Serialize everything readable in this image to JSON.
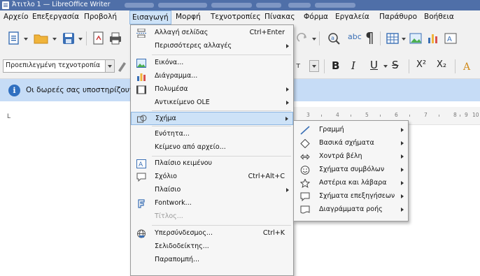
{
  "window": {
    "title": "Άτιτλο 1 — LibreOffice Writer"
  },
  "menubar": [
    {
      "label": "Αρχείο",
      "name": "menu-file"
    },
    {
      "label": "Επεξεργασία",
      "name": "menu-edit"
    },
    {
      "label": "Προβολή",
      "name": "menu-view"
    },
    {
      "label": "Εισαγωγή",
      "name": "menu-insert",
      "active": true
    },
    {
      "label": "Μορφή",
      "name": "menu-format"
    },
    {
      "label": "Τεχνοτροπίες",
      "name": "menu-styles"
    },
    {
      "label": "Πίνακας",
      "name": "menu-table"
    },
    {
      "label": "Φόρμα",
      "name": "menu-form"
    },
    {
      "label": "Εργαλεία",
      "name": "menu-tools"
    },
    {
      "label": "Παράθυρο",
      "name": "menu-window"
    },
    {
      "label": "Βοήθεια",
      "name": "menu-help"
    }
  ],
  "toolbar": {
    "paragraph_style": "Προεπιλεγμένη τεχνοτροπία",
    "bold": "B",
    "italic": "I",
    "underline": "U",
    "strikethrough": "S",
    "superscript": "X²",
    "subscript": "X₂",
    "paragraph_mark": "¶",
    "spellcheck": "abc"
  },
  "infobar": {
    "message": "Οι δωρεές σας υποστηρίζουν"
  },
  "ruler": {
    "ticks": [
      "3",
      "4",
      "5",
      "6",
      "7",
      "8",
      "9",
      "10"
    ]
  },
  "insert_menu": {
    "items": [
      {
        "label": "Αλλαγή σελίδας",
        "shortcut": "Ctrl+Enter",
        "icon": "page-break-icon"
      },
      {
        "label": "Περισσότερες αλλαγές",
        "submenu": true
      },
      {
        "label": "Εικόνα...",
        "icon": "image-icon"
      },
      {
        "label": "Διάγραμμα...",
        "icon": "chart-icon"
      },
      {
        "label": "Πολυμέσα",
        "icon": "media-icon",
        "submenu": true
      },
      {
        "label": "Αντικείμενο OLE",
        "submenu": true
      },
      {
        "label": "Σχήμα",
        "icon": "shape-icon",
        "submenu": true,
        "highlighted": true
      },
      {
        "label": "Ενότητα..."
      },
      {
        "label": "Κείμενο από αρχείο..."
      },
      {
        "label": "Πλαίσιο κειμένου",
        "icon": "text-box-icon"
      },
      {
        "label": "Σχόλιο",
        "shortcut": "Ctrl+Alt+C",
        "icon": "comment-icon"
      },
      {
        "label": "Πλαίσιο",
        "submenu": true
      },
      {
        "label": "Fontwork...",
        "icon": "fontwork-icon"
      },
      {
        "label": "Τίτλος...",
        "disabled": true
      },
      {
        "label": "Υπερσύνδεσμος...",
        "shortcut": "Ctrl+K",
        "icon": "hyperlink-icon"
      },
      {
        "label": "Σελιδοδείκτης..."
      },
      {
        "label": "Παραπομπή..."
      }
    ]
  },
  "shape_submenu": {
    "items": [
      {
        "label": "Γραμμή",
        "icon": "line-icon"
      },
      {
        "label": "Βασικά σχήματα",
        "icon": "diamond-icon"
      },
      {
        "label": "Χοντρά βέλη",
        "icon": "double-arrow-icon"
      },
      {
        "label": "Σχήματα συμβόλων",
        "icon": "smiley-icon"
      },
      {
        "label": "Αστέρια και λάβαρα",
        "icon": "star-icon"
      },
      {
        "label": "Σχήματα επεξηγήσεων",
        "icon": "callout-icon"
      },
      {
        "label": "Διαγράμματα ροής",
        "icon": "flowchart-icon"
      }
    ]
  },
  "colors": {
    "titlebar": "#4f6fa8",
    "highlight": "#cde2f7",
    "highlight_border": "#8eb7e3",
    "infobar": "#c6dcf6"
  }
}
